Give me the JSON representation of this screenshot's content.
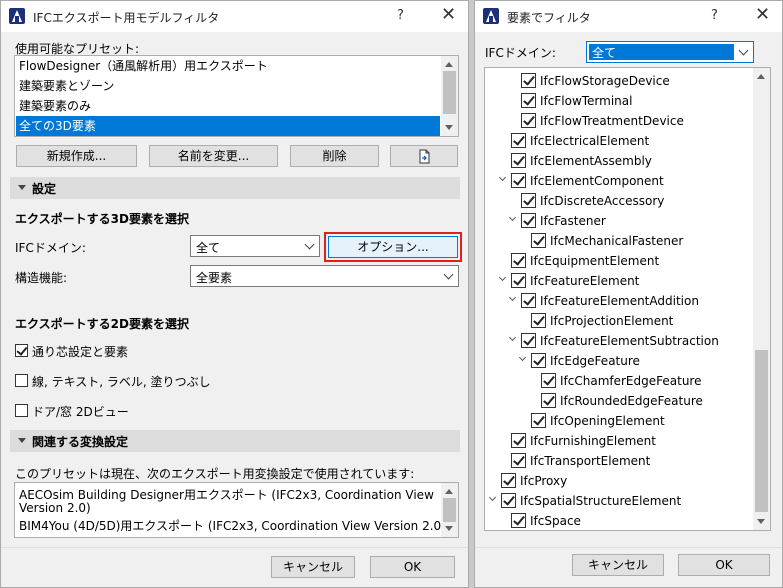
{
  "export_dialog": {
    "title": "IFCエクスポート用モデルフィルタ",
    "help": "?",
    "close": "✕",
    "presets_label": "使用可能なプリセット:",
    "presets": [
      "FlowDesigner（通風解析用）用エクスポート",
      "建築要素とゾーン",
      "建築要素のみ",
      "全ての3D要素"
    ],
    "selected_preset": 3,
    "buttons": {
      "new": "新規作成...",
      "rename": "名前を変更...",
      "delete": "削除"
    },
    "settings_section": "設定",
    "export_3d_heading": "エクスポートする3D要素を選択",
    "ifc_domain_label": "IFCドメイン:",
    "ifc_domain_value": "全て",
    "options_button": "オプション...",
    "structural_label": "構造機能:",
    "structural_value": "全要素",
    "export_2d_heading": "エクスポートする2D要素を選択",
    "checkboxes": [
      {
        "label": "通り芯設定と要素",
        "checked": true
      },
      {
        "label": "線, テキスト, ラベル, 塗りつぶし",
        "checked": false
      },
      {
        "label": "ドア/窓 2Dビュー",
        "checked": false
      }
    ],
    "related_section": "関連する変換設定",
    "related_desc": "このプリセットは現在、次のエクスポート用変換設定で使用されています:",
    "related_lines": [
      "AECOsim Building Designer用エクスポート (IFC2x3, Coordination View",
      "Version 2.0)",
      "BIM4You (4D/5D)用エクスポート (IFC2x3, Coordination View Version 2.0)"
    ],
    "cancel": "キャンセル",
    "ok": "OK"
  },
  "filter_dialog": {
    "title": "要素でフィルタ",
    "help": "?",
    "close": "✕",
    "domain_label": "IFCドメイン:",
    "domain_value": "全て",
    "tree": [
      {
        "label": "IfcFlowStorageDevice",
        "level": 3,
        "expander": false
      },
      {
        "label": "IfcFlowTerminal",
        "level": 3,
        "expander": false
      },
      {
        "label": "IfcFlowTreatmentDevice",
        "level": 3,
        "expander": false
      },
      {
        "label": "IfcElectricalElement",
        "level": 2,
        "expander": false
      },
      {
        "label": "IfcElementAssembly",
        "level": 2,
        "expander": false
      },
      {
        "label": "IfcElementComponent",
        "level": 2,
        "expander": true
      },
      {
        "label": "IfcDiscreteAccessory",
        "level": 3,
        "expander": false
      },
      {
        "label": "IfcFastener",
        "level": 3,
        "expander": true
      },
      {
        "label": "IfcMechanicalFastener",
        "level": 4,
        "expander": false
      },
      {
        "label": "IfcEquipmentElement",
        "level": 2,
        "expander": false
      },
      {
        "label": "IfcFeatureElement",
        "level": 2,
        "expander": true
      },
      {
        "label": "IfcFeatureElementAddition",
        "level": 3,
        "expander": true
      },
      {
        "label": "IfcProjectionElement",
        "level": 4,
        "expander": false
      },
      {
        "label": "IfcFeatureElementSubtraction",
        "level": 3,
        "expander": true
      },
      {
        "label": "IfcEdgeFeature",
        "level": 4,
        "expander": true
      },
      {
        "label": "IfcChamferEdgeFeature",
        "level": 5,
        "expander": false
      },
      {
        "label": "IfcRoundedEdgeFeature",
        "level": 5,
        "expander": false
      },
      {
        "label": "IfcOpeningElement",
        "level": 4,
        "expander": false
      },
      {
        "label": "IfcFurnishingElement",
        "level": 2,
        "expander": false
      },
      {
        "label": "IfcTransportElement",
        "level": 2,
        "expander": false
      },
      {
        "label": "IfcProxy",
        "level": 1,
        "expander": false
      },
      {
        "label": "IfcSpatialStructureElement",
        "level": 1,
        "expander": true
      },
      {
        "label": "IfcSpace",
        "level": 2,
        "expander": false
      }
    ],
    "cancel": "キャンセル",
    "ok": "OK"
  }
}
